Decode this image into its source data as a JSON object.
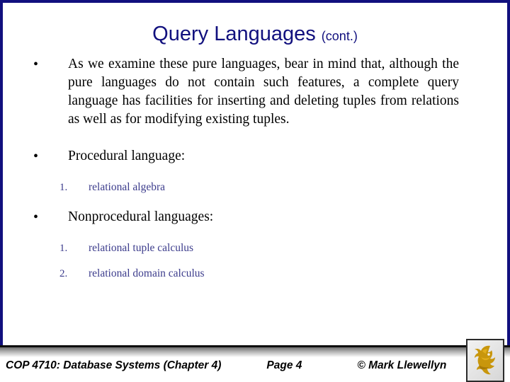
{
  "slide": {
    "title_main": "Query Languages",
    "title_suffix": "(cont.)",
    "accent_navy": "#11107e",
    "subitem_blue": "#3c3c8c",
    "body_black": "#000000",
    "logo_gold": "#c8960c"
  },
  "bullets": [
    {
      "marker": "•",
      "text": "As we examine these pure languages, bear in mind that, although the pure languages do not contain such features, a complete query language has facilities for inserting and deleting tuples from relations as well as for modifying existing tuples."
    },
    {
      "marker": "•",
      "text": "Procedural language:"
    },
    {
      "marker": "•",
      "text": "Nonprocedural languages:"
    }
  ],
  "procedural_items": [
    {
      "number": "1.",
      "text": "relational algebra"
    }
  ],
  "nonprocedural_items": [
    {
      "number": "1.",
      "text": "relational tuple calculus"
    },
    {
      "number": "2.",
      "text": "relational domain calculus"
    }
  ],
  "footer": {
    "course": "COP 4710: Database Systems  (Chapter 4)",
    "page": "Page 4",
    "copyright": "© Mark",
    "author_wrapped": "Llewellyn",
    "logo_name": "ucf-pegasus-logo"
  }
}
